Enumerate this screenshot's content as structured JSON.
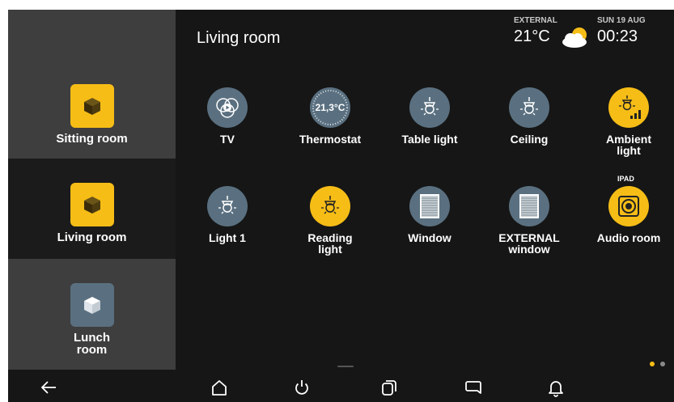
{
  "header": {
    "title": "Living room",
    "external_label": "EXTERNAL",
    "external_temp": "21°C",
    "weather_icon": "partly-cloudy-icon",
    "date": "SUN 19 AUG",
    "time": "00:23"
  },
  "sidebar": {
    "rooms": [
      {
        "label": "Sitting room",
        "selected": false,
        "icon": "cube-icon",
        "color": "#f6bd16"
      },
      {
        "label": "Living room",
        "selected": true,
        "icon": "cube-icon",
        "color": "#f6bd16"
      },
      {
        "label": "Lunch room",
        "selected": false,
        "icon": "cube-icon",
        "color": "#5a7080"
      }
    ]
  },
  "devices": [
    {
      "label": "TV",
      "icon": "tv-icon",
      "active": false
    },
    {
      "label": "Thermostat",
      "icon": "thermostat-icon",
      "value": "21,3°C",
      "active": false
    },
    {
      "label": "Table light",
      "icon": "lamp-icon",
      "active": false
    },
    {
      "label": "Ceiling",
      "icon": "lamp-icon",
      "active": false
    },
    {
      "label": "Ambient light",
      "icon": "dimmer-lamp-icon",
      "active": true
    },
    {
      "label": "Light 1",
      "icon": "lamp-icon",
      "active": false
    },
    {
      "label": "Reading light",
      "icon": "lamp-icon",
      "active": true
    },
    {
      "label": "Window",
      "icon": "window-icon",
      "active": false
    },
    {
      "label": "EXTERNAL window",
      "icon": "window-icon",
      "active": false
    },
    {
      "label": "Audio room",
      "icon": "speaker-icon",
      "tag": "IPAD",
      "active": true
    }
  ],
  "bottom_nav": [
    "back-icon",
    "home-icon",
    "power-icon",
    "scenes-icon",
    "message-icon",
    "bell-icon"
  ],
  "pager": {
    "pages": 2,
    "current": 1
  },
  "colors": {
    "accent": "#f6bd16",
    "inactive": "#5a7080",
    "background": "#161616",
    "panel": "#3e3e3e"
  }
}
